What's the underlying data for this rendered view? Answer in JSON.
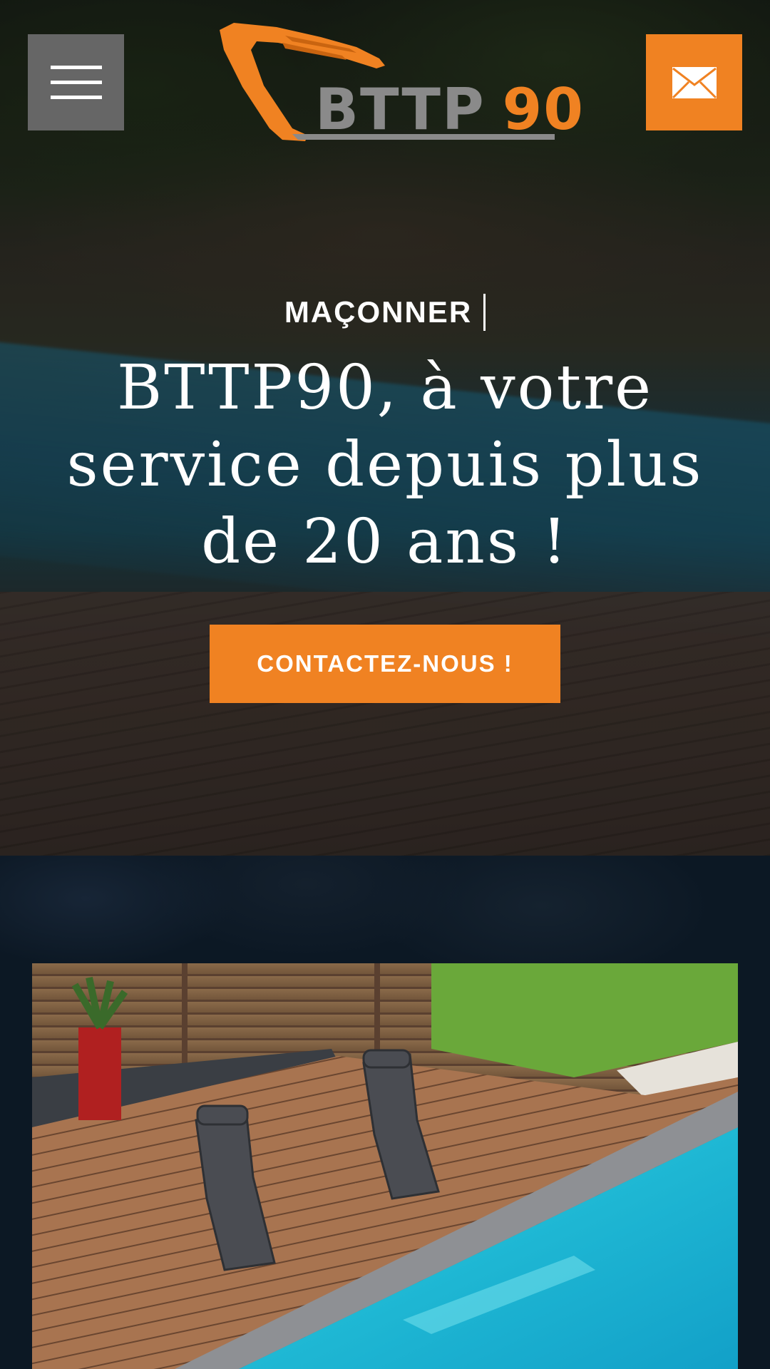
{
  "header": {
    "menu_icon": "hamburger-menu-icon",
    "mail_icon": "envelope-icon",
    "logo": {
      "text_main": "BTTP",
      "text_accent": "90",
      "icon": "excavator-logo-icon"
    }
  },
  "hero": {
    "eyebrow": "MAÇONNER",
    "headline": "BTTP90, à votre service depuis plus de 20 ans !",
    "cta_label": "CONTACTEZ-NOUS !"
  },
  "colors": {
    "accent": "#f08222",
    "menu_button": "#666666",
    "section_bg": "#0c1824"
  }
}
